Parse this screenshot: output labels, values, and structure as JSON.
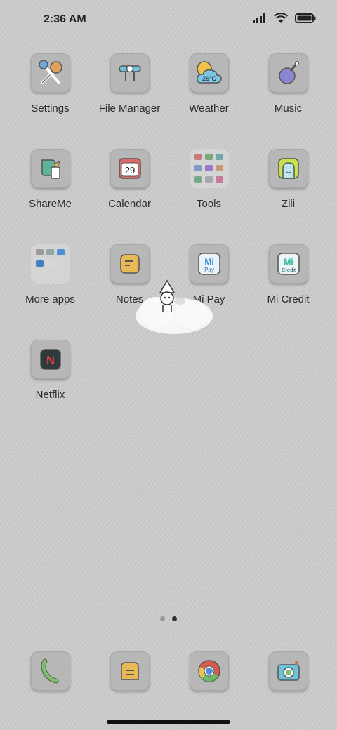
{
  "status": {
    "time": "2:36 AM"
  },
  "apps": [
    {
      "label": "Settings",
      "icon": "settings-icon"
    },
    {
      "label": "File Manager",
      "icon": "file-manager-icon"
    },
    {
      "label": "Weather",
      "icon": "weather-icon",
      "badge": "26°C"
    },
    {
      "label": "Music",
      "icon": "music-icon"
    },
    {
      "label": "ShareMe",
      "icon": "shareme-icon"
    },
    {
      "label": "Calendar",
      "icon": "calendar-icon",
      "badge": "29"
    },
    {
      "label": "Tools",
      "icon": "tools-folder-icon"
    },
    {
      "label": "Zili",
      "icon": "zili-icon"
    },
    {
      "label": "More apps",
      "icon": "more-apps-folder-icon"
    },
    {
      "label": "Notes",
      "icon": "notes-icon"
    },
    {
      "label": "Mi Pay",
      "icon": "mi-pay-icon"
    },
    {
      "label": "Mi Credit",
      "icon": "mi-credit-icon"
    },
    {
      "label": "Netflix",
      "icon": "netflix-icon"
    }
  ],
  "icon_text": {
    "mi_pay_1": "Mi",
    "mi_pay_2": "Pay",
    "mi_credit_1": "Mi",
    "mi_credit_2": "Credit",
    "netflix": "N"
  },
  "page_indicator": {
    "pages": 2,
    "current": 2
  },
  "dock": [
    {
      "icon": "phone-icon"
    },
    {
      "icon": "messages-icon"
    },
    {
      "icon": "chrome-icon"
    },
    {
      "icon": "camera-icon"
    }
  ],
  "colors": {
    "background": "#c9c9c9",
    "tile": "#b7b7b7",
    "label": "#2b2b2b"
  }
}
